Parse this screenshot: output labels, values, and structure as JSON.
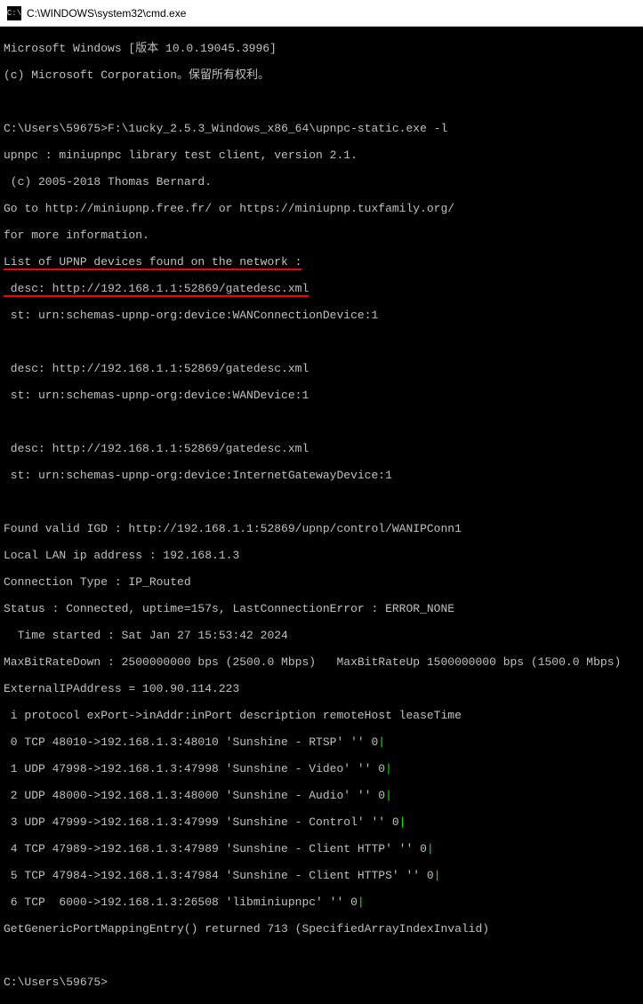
{
  "titlebar": {
    "icon_text": "C:\\",
    "title": "C:\\WINDOWS\\system32\\cmd.exe"
  },
  "header": {
    "line1": "Microsoft Windows [版本 10.0.19045.3996]",
    "line2": "(c) Microsoft Corporation。保留所有权利。"
  },
  "command": {
    "prompt1": "C:\\Users\\59675>",
    "cmd1": "F:\\1ucky_2.5.3_Windows_x86_64\\upnpc-static.exe -l"
  },
  "upnpc_header": {
    "l1": "upnpc : miniupnpc library test client, version 2.1.",
    "l2": " (c) 2005-2018 Thomas Bernard.",
    "l3": "Go to http://miniupnp.free.fr/ or https://miniupnp.tuxfamily.org/",
    "l4": "for more information.",
    "l5": "List of UPNP devices found on the network :"
  },
  "devices": {
    "d1_desc": " desc: http://192.168.1.1:52869/gatedesc.xml",
    "d1_st": " st: urn:schemas-upnp-org:device:WANConnectionDevice:1",
    "d2_desc": " desc: http://192.168.1.1:52869/gatedesc.xml",
    "d2_st": " st: urn:schemas-upnp-org:device:WANDevice:1",
    "d3_desc": " desc: http://192.168.1.1:52869/gatedesc.xml",
    "d3_st": " st: urn:schemas-upnp-org:device:InternetGatewayDevice:1"
  },
  "status": {
    "igd": "Found valid IGD : http://192.168.1.1:52869/upnp/control/WANIPConn1",
    "lan": "Local LAN ip address : 192.168.1.3",
    "conn_type": "Connection Type : IP_Routed",
    "stat": "Status : Connected, uptime=157s, LastConnectionError : ERROR_NONE",
    "time": "  Time started : Sat Jan 27 15:53:42 2024",
    "bitrate": "MaxBitRateDown : 2500000000 bps (2500.0 Mbps)   MaxBitRateUp 1500000000 bps (1500.0 Mbps)",
    "extip": "ExternalIPAddress = 100.90.114.223"
  },
  "mappings": {
    "header": " i protocol exPort->inAddr:inPort description remoteHost leaseTime",
    "r0": " 0 TCP 48010->192.168.1.3:48010 'Sunshine - RTSP' '' 0",
    "r1": " 1 UDP 47998->192.168.1.3:47998 'Sunshine - Video' '' 0",
    "r2": " 2 UDP 48000->192.168.1.3:48000 'Sunshine - Audio' '' 0",
    "r3": " 3 UDP 47999->192.168.1.3:47999 'Sunshine - Control' '' 0",
    "r4": " 4 TCP 47989->192.168.1.3:47989 'Sunshine - Client HTTP' '' 0",
    "r5": " 5 TCP 47984->192.168.1.3:47984 'Sunshine - Client HTTPS' '' 0",
    "r6": " 6 TCP  6000->192.168.1.3:26508 'libminiupnpc' '' 0",
    "footer": "GetGenericPortMappingEntry() returned 713 (SpecifiedArrayIndexInvalid)"
  },
  "final_prompt": "C:\\Users\\59675>",
  "pipe": "|"
}
